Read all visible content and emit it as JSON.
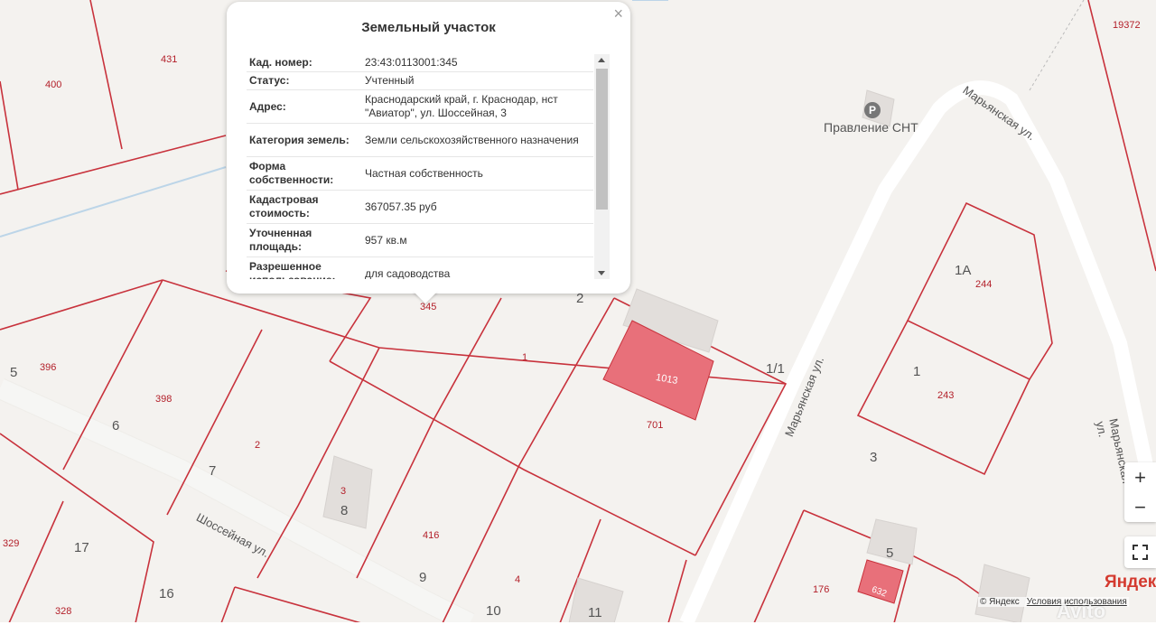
{
  "popup": {
    "title": "Земельный участок",
    "close": "×",
    "rows": [
      {
        "key": "Кад. номер:",
        "value": "23:43:0113001:345"
      },
      {
        "key": "Статус:",
        "value": "Учтенный"
      },
      {
        "key": "Адрес:",
        "value": "Краснодарский край, г. Краснодар, нст \"Авиатор\", ул. Шоссейная, 3"
      },
      {
        "key": "Категория земель:",
        "value": "Земли сельскохозяйственного назначения"
      },
      {
        "key": "Форма собственности:",
        "value": "Частная собственность"
      },
      {
        "key": "Кадастровая стоимость:",
        "value": "367057.35 руб"
      },
      {
        "key": "Уточненная площадь:",
        "value": "957 кв.м"
      },
      {
        "key": "Разрешенное использование:",
        "value": "для садоводства"
      }
    ]
  },
  "map": {
    "parcel_numbers": [
      "400",
      "431",
      "19372",
      "396",
      "398",
      "2",
      "3",
      "416",
      "4",
      "345",
      "1",
      "701",
      "1013",
      "244",
      "243",
      "176",
      "632",
      "329",
      "328"
    ],
    "house_numbers": [
      "5",
      "6",
      "7",
      "8",
      "9",
      "10",
      "11",
      "17",
      "16",
      "3",
      "1",
      "1А",
      "2",
      "1/1",
      "5"
    ],
    "streets": [
      "Шоссейная ул.",
      "Марьянская ул.",
      "Марьянская ул.",
      "Марьянская ул."
    ],
    "poi": {
      "label": "Правление СНТ",
      "icon": "parking-icon"
    },
    "colors": {
      "parcel_line": "#c8323c",
      "parcel_fill": "#e8707a",
      "road": "#ffffff",
      "background": "#f4f2ef"
    }
  },
  "controls": {
    "zoom_in": "+",
    "zoom_out": "−",
    "fullscreen_icon": "fullscreen-icon"
  },
  "branding": {
    "logo": "Яндекс",
    "copyright": "© Яндекс",
    "terms": "Условия использования",
    "watermark": "Avito"
  }
}
